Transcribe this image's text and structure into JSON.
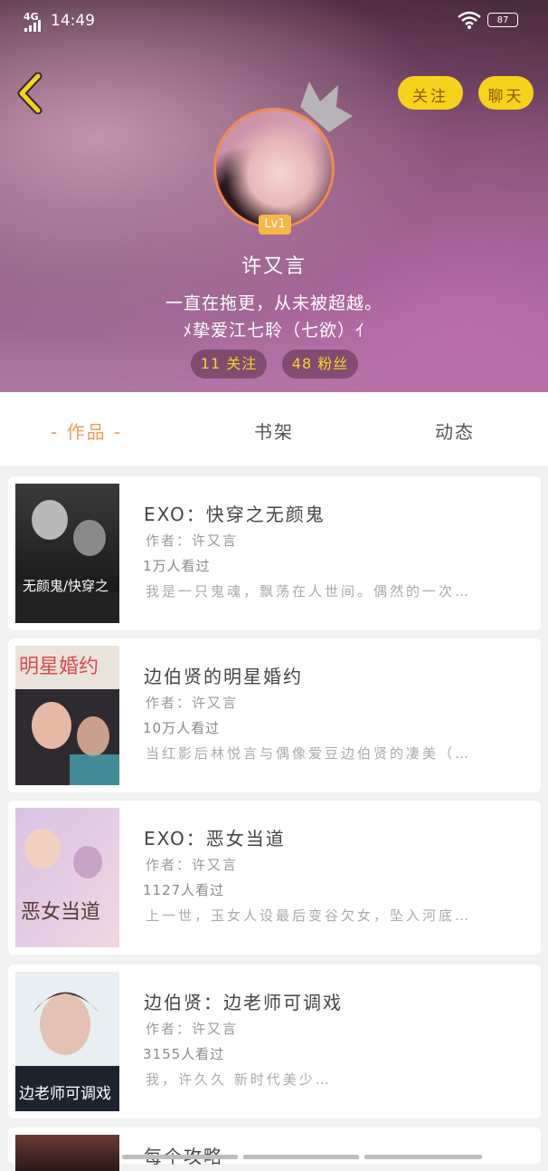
{
  "status_bar": {
    "network": "4G",
    "time": "14:49",
    "battery": "87"
  },
  "header": {
    "follow_label": "关注",
    "chat_label": "聊天",
    "level": "Lv1",
    "user_name": "许又言",
    "bio_line1": "一直在拖更，从未被超越。",
    "bio_line2": "ﾒ挚爱江七聆（七欲）ｲ",
    "following_count": "11",
    "following_label": "关注",
    "fans_count": "48",
    "fans_label": "粉丝"
  },
  "tabs": [
    {
      "label": "- 作品 -",
      "active": true
    },
    {
      "label": "书架",
      "active": false
    },
    {
      "label": "动态",
      "active": false
    }
  ],
  "books": [
    {
      "title": "EXO：快穿之无颜鬼",
      "author": "作者：许又言",
      "views": "1万人看过",
      "desc": "我是一只鬼魂，飘荡在人世间。偶然的一次…",
      "cover_text": "无颜鬼/快穿之"
    },
    {
      "title": "边伯贤的明星婚约",
      "author": "作者：许又言",
      "views": "10万人看过",
      "desc": "当红影后林悦言与偶像爱豆边伯贤的凄美（…",
      "cover_text": "明星婚约"
    },
    {
      "title": "EXO：恶女当道",
      "author": "作者：许又言",
      "views": "1127人看过",
      "desc": "上一世，玉女人设最后变谷欠女，坠入河底…",
      "cover_text": "恶女当道"
    },
    {
      "title": "边伯贤：边老师可调戏",
      "author": "作者：许又言",
      "views": "3155人看过",
      "desc": "我，许久久 新时代美少…",
      "cover_text": "边老师可调戏"
    },
    {
      "title": "每个攻略"
    }
  ],
  "colors": {
    "accent": "#f29b5a",
    "pill_yellow": "#f7d21c",
    "level_badge": "#f6b64a"
  }
}
